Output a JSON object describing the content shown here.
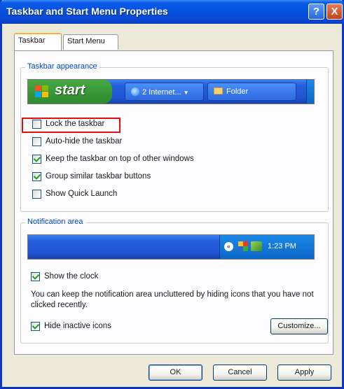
{
  "window": {
    "title": "Taskbar and Start Menu Properties",
    "help_label": "?",
    "close_label": "X",
    "title_color": "#0550df"
  },
  "tabs": [
    {
      "label": "Taskbar",
      "active": true
    },
    {
      "label": "Start Menu",
      "active": false
    }
  ],
  "taskbar_appearance": {
    "label": "Taskbar appearance",
    "preview": {
      "start_label": "start",
      "buttons": [
        "2 Internet...",
        "Folder"
      ]
    },
    "options": [
      {
        "label": "Lock the taskbar",
        "checked": false,
        "highlighted": true
      },
      {
        "label": "Auto-hide the taskbar",
        "checked": false
      },
      {
        "label": "Keep the taskbar on top of other windows",
        "checked": true
      },
      {
        "label": "Group similar taskbar buttons",
        "checked": true
      },
      {
        "label": "Show Quick Launch",
        "checked": false
      }
    ]
  },
  "notification_area": {
    "label": "Notification area",
    "preview": {
      "clock": "1:23 PM"
    },
    "show_clock": {
      "label": "Show the clock",
      "checked": true
    },
    "info": "You can keep the notification area uncluttered by hiding icons that you have not clicked recently.",
    "hide_inactive": {
      "label": "Hide inactive icons",
      "checked": true
    },
    "customize_label": "Customize..."
  },
  "buttons": {
    "ok": "OK",
    "cancel": "Cancel",
    "apply": "Apply"
  },
  "colors": {
    "highlight": "#e01010",
    "group_label": "#0046d5",
    "start_green": "#3c9b3a"
  }
}
